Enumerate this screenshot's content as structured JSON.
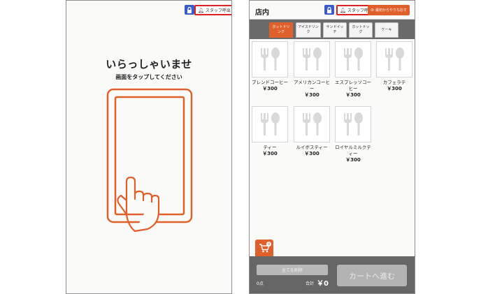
{
  "colors": {
    "accent": "#e0602b",
    "lock": "#3a5cc8",
    "staff_border": "#e02020",
    "bar": "#666666"
  },
  "left": {
    "staff_call_label": "スタッフ呼出",
    "title": "いらっしゃいませ",
    "subtitle": "画面をタップしてください"
  },
  "right": {
    "store_label": "店内",
    "staff_call_label": "スタッフ呼出",
    "restart_label": "最初からやりなおす",
    "tabs": [
      "ホットドリンク",
      "アイスドリンク",
      "サンドイッチ",
      "ホットドッグ",
      "ケーキ"
    ],
    "active_tab": 0,
    "products": [
      {
        "name": "ブレンドコーヒー",
        "price": "￥300"
      },
      {
        "name": "アメリカンコーヒー",
        "price": "￥300"
      },
      {
        "name": "エスプレッソコーヒー",
        "price": "￥300"
      },
      {
        "name": "カフェラテ",
        "price": "￥300"
      },
      {
        "name": "ティー",
        "price": "￥300"
      },
      {
        "name": "ルイボスティー",
        "price": "￥300"
      },
      {
        "name": "ロイヤルミルクティー",
        "price": "￥300"
      }
    ],
    "cart_badge": "0",
    "delete_all_label": "全てを削除",
    "item_count": "0点",
    "total_label": "合計",
    "total_value": "￥0",
    "to_cart_label": "カートへ進む"
  }
}
